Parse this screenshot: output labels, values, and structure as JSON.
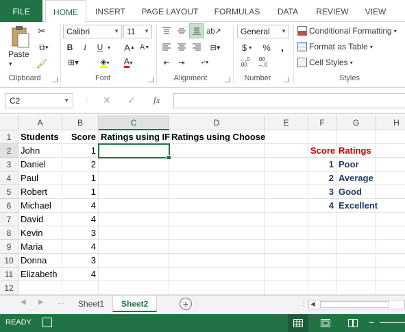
{
  "ribbon_tabs": [
    "FILE",
    "HOME",
    "INSERT",
    "PAGE LAYOUT",
    "FORMULAS",
    "DATA",
    "REVIEW",
    "VIEW"
  ],
  "clipboard": {
    "paste_label": "Paste",
    "group_label": "Clipboard"
  },
  "font": {
    "name": "Calibri",
    "size": "11",
    "group_label": "Font",
    "bold": "B",
    "italic": "I",
    "underline": "U"
  },
  "alignment": {
    "group_label": "Alignment"
  },
  "number": {
    "format": "General",
    "currency": "$",
    "percent": "%",
    "comma": ",",
    "group_label": "Number"
  },
  "styles": {
    "conditional": "Conditional Formatting",
    "format_table": "Format as Table",
    "cell_styles": "Cell Styles",
    "group_label": "Styles"
  },
  "formula_bar": {
    "name_box": "C2",
    "fx": "fx",
    "cancel": "✕",
    "enter": "✓",
    "value": ""
  },
  "columns": [
    "A",
    "B",
    "C",
    "D",
    "E",
    "F",
    "G",
    "H"
  ],
  "selected_column": "C",
  "selected_row": "2",
  "rows": [
    {
      "n": "1",
      "A": "Students",
      "B": "Score",
      "C": "Ratings using IF",
      "D": "Ratings using Choose",
      "F": "",
      "G": ""
    },
    {
      "n": "2",
      "A": "John",
      "B": "1",
      "C": "",
      "D": "",
      "F": "Score",
      "G": "Ratings"
    },
    {
      "n": "3",
      "A": "Daniel",
      "B": "2",
      "C": "",
      "D": "",
      "F": "1",
      "G": "Poor"
    },
    {
      "n": "4",
      "A": "Paul",
      "B": "1",
      "C": "",
      "D": "",
      "F": "2",
      "G": "Average"
    },
    {
      "n": "5",
      "A": "Robert",
      "B": "1",
      "C": "",
      "D": "",
      "F": "3",
      "G": "Good"
    },
    {
      "n": "6",
      "A": "Michael",
      "B": "4",
      "C": "",
      "D": "",
      "F": "4",
      "G": "Excellent"
    },
    {
      "n": "7",
      "A": "David",
      "B": "4",
      "C": "",
      "D": "",
      "F": "",
      "G": ""
    },
    {
      "n": "8",
      "A": "Kevin",
      "B": "3",
      "C": "",
      "D": "",
      "F": "",
      "G": ""
    },
    {
      "n": "9",
      "A": "Maria",
      "B": "4",
      "C": "",
      "D": "",
      "F": "",
      "G": ""
    },
    {
      "n": "10",
      "A": "Donna",
      "B": "3",
      "C": "",
      "D": "",
      "F": "",
      "G": ""
    },
    {
      "n": "11",
      "A": "Elizabeth",
      "B": "4",
      "C": "",
      "D": "",
      "F": "",
      "G": ""
    },
    {
      "n": "12",
      "A": "",
      "B": "",
      "C": "",
      "D": "",
      "F": "",
      "G": ""
    }
  ],
  "sheets": [
    "Sheet1",
    "Sheet2"
  ],
  "active_sheet": "Sheet2",
  "status": {
    "mode": "READY"
  },
  "colors": {
    "accent": "#217346",
    "red_header": "#c00000",
    "blue_text": "#1f3864"
  }
}
